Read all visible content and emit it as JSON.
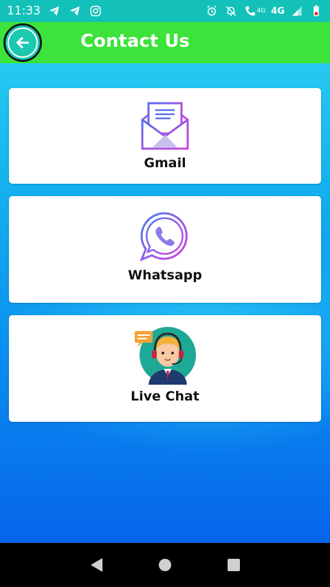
{
  "status_bar": {
    "time": "11:33",
    "network_label": "4G",
    "network_label_small": "4G",
    "left_icons": [
      "telegram-icon",
      "telegram-icon",
      "instagram-icon"
    ],
    "right_icons": [
      "alarm-icon",
      "bell-off-icon",
      "call-icon",
      "signal-icon",
      "battery-icon"
    ]
  },
  "app_bar": {
    "title": "Contact Us",
    "back_icon": "arrow-left-icon",
    "color": "#3ce33a"
  },
  "contact_options": [
    {
      "label": "Gmail",
      "icon": "envelope-icon"
    },
    {
      "label": "Whatsapp",
      "icon": "whatsapp-icon"
    },
    {
      "label": "Live Chat",
      "icon": "support-agent-icon"
    }
  ],
  "nav_bar": {
    "buttons": [
      "back-triangle-icon",
      "home-circle-icon",
      "recents-square-icon"
    ]
  }
}
